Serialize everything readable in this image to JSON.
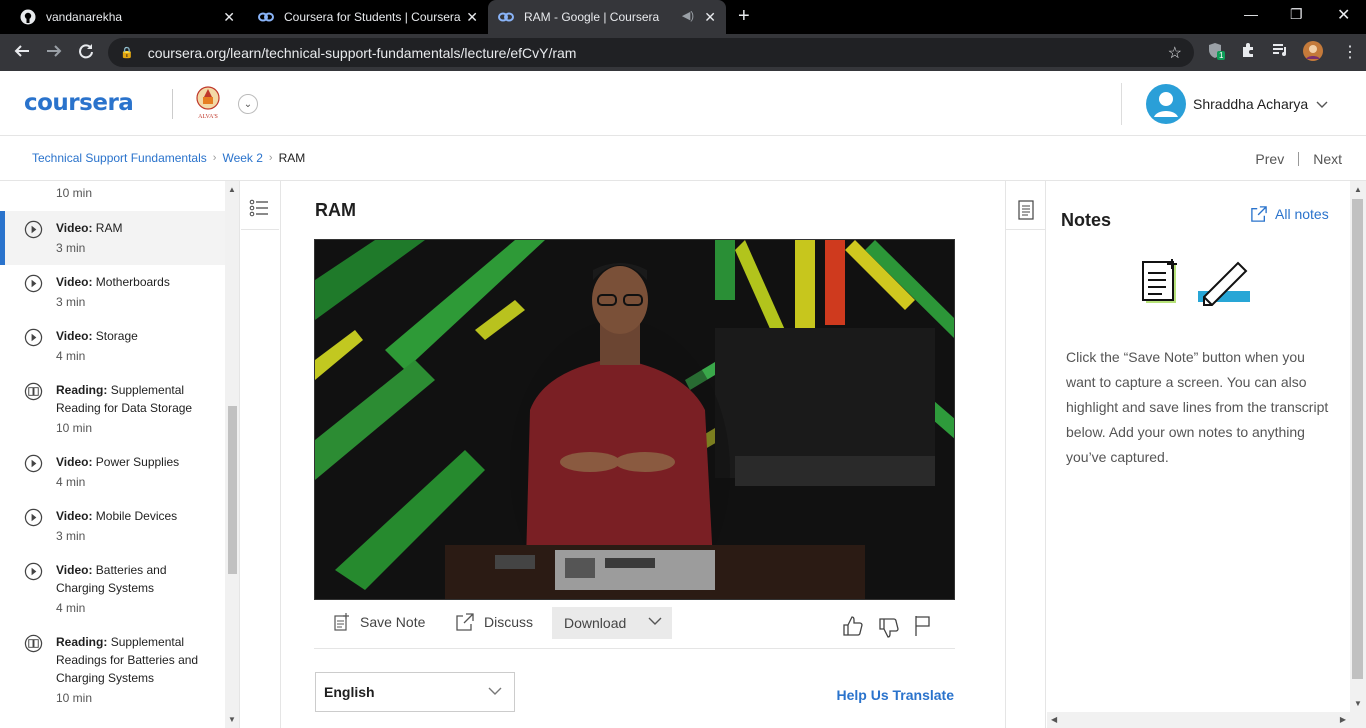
{
  "browser": {
    "tabs": [
      {
        "title": "vandanarekha",
        "active": false
      },
      {
        "title": "Coursera for Students | Coursera",
        "active": false
      },
      {
        "title": "RAM - Google | Coursera",
        "active": true
      }
    ],
    "url": "coursera.org/learn/technical-support-fundamentals/lecture/efCvY/ram",
    "extension_badge": "1"
  },
  "header": {
    "logo": "coursera",
    "partner_caption": "ALVA'S",
    "user_name": "Shraddha Acharya"
  },
  "breadcrumb": {
    "course": "Technical Support Fundamentals",
    "week": "Week 2",
    "current": "RAM",
    "sep": "›",
    "prev": "Prev",
    "next": "Next"
  },
  "sidebar": {
    "top_duration": "10 min",
    "items": [
      {
        "kind": "Video:",
        "title": "RAM",
        "duration": "3 min",
        "icon": "play-icon",
        "active": true
      },
      {
        "kind": "Video:",
        "title": "Motherboards",
        "duration": "3 min",
        "icon": "play-icon",
        "active": false
      },
      {
        "kind": "Video:",
        "title": "Storage",
        "duration": "4 min",
        "icon": "play-icon",
        "active": false
      },
      {
        "kind": "Reading:",
        "title": "Supplemental Reading for Data Storage",
        "duration": "10 min",
        "icon": "book-icon",
        "active": false
      },
      {
        "kind": "Video:",
        "title": "Power Supplies",
        "duration": "4 min",
        "icon": "play-icon",
        "active": false
      },
      {
        "kind": "Video:",
        "title": "Mobile Devices",
        "duration": "3 min",
        "icon": "play-icon",
        "active": false
      },
      {
        "kind": "Video:",
        "title": "Batteries and Charging Systems",
        "duration": "4 min",
        "icon": "play-icon",
        "active": false
      },
      {
        "kind": "Reading:",
        "title": "Supplemental Readings for Batteries and Charging Systems",
        "duration": "10 min",
        "icon": "book-icon",
        "active": false
      }
    ]
  },
  "main": {
    "lecture_title": "RAM",
    "toolbar": {
      "save_note": "Save Note",
      "discuss": "Discuss",
      "download": "Download"
    },
    "language": "English",
    "help_translate": "Help Us Translate"
  },
  "notes": {
    "title": "Notes",
    "all_notes": "All notes",
    "description": "Click the “Save Note” button when you want to capture a screen. You can also highlight and save lines from the transcript below. Add your own notes to anything you’ve captured."
  },
  "colors": {
    "brand": "#2a73cc",
    "browser_bg": "#000000",
    "toolbar_bg": "#35363a",
    "avatar": "#2a9fd8"
  }
}
